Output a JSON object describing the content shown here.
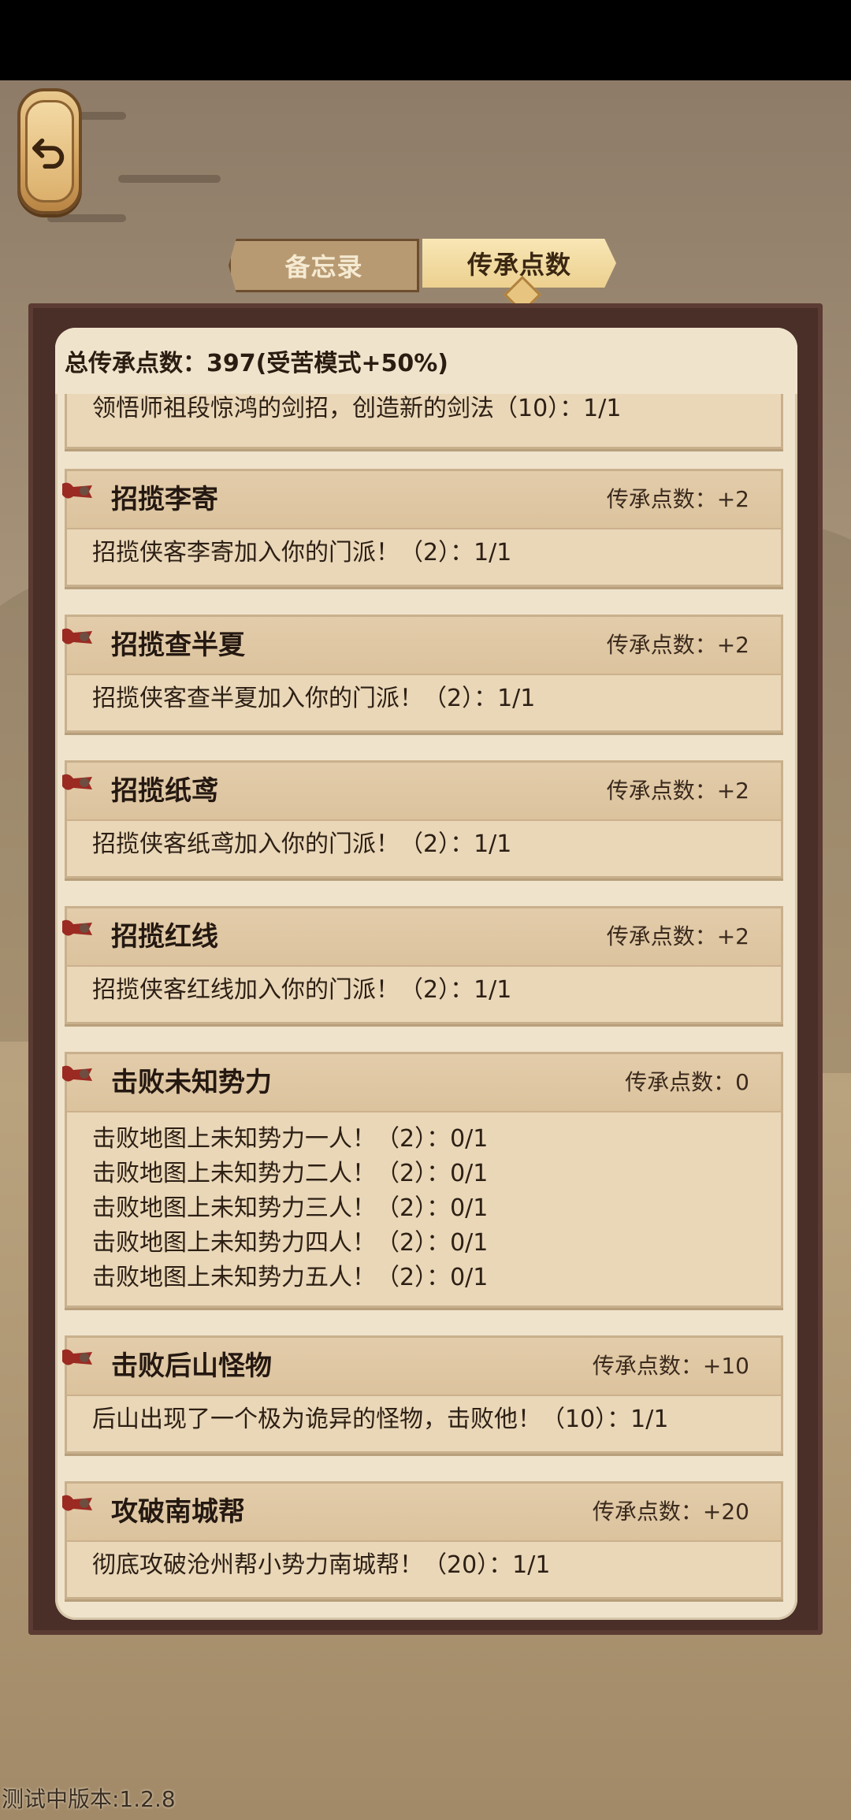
{
  "tabs": {
    "memo_label": "备忘录",
    "points_label": "传承点数"
  },
  "summary": {
    "total_label": "总传承点数：397(受苦模式+50%)"
  },
  "partial_top_item": {
    "line": "领悟师祖段惊鸿的剑招，创造新的剑法（10）：1/1"
  },
  "items": [
    {
      "title": "招揽李寄",
      "points": "传承点数：+2",
      "lines": [
        "招揽侠客李寄加入你的门派！（2）：1/1"
      ]
    },
    {
      "title": "招揽查半夏",
      "points": "传承点数：+2",
      "lines": [
        "招揽侠客查半夏加入你的门派！（2）：1/1"
      ]
    },
    {
      "title": "招揽纸鸢",
      "points": "传承点数：+2",
      "lines": [
        "招揽侠客纸鸢加入你的门派！（2）：1/1"
      ]
    },
    {
      "title": "招揽红线",
      "points": "传承点数：+2",
      "lines": [
        "招揽侠客红线加入你的门派！（2）：1/1"
      ]
    },
    {
      "title": "击败未知势力",
      "points": "传承点数：0",
      "lines": [
        "击败地图上未知势力一人！（2）：0/1",
        "击败地图上未知势力二人！（2）：0/1",
        "击败地图上未知势力三人！（2）：0/1",
        "击败地图上未知势力四人！（2）：0/1",
        "击败地图上未知势力五人！（2）：0/1"
      ]
    },
    {
      "title": "击败后山怪物",
      "points": "传承点数：+10",
      "lines": [
        "后山出现了一个极为诡异的怪物，击败他！（10）：1/1"
      ]
    },
    {
      "title": "攻破南城帮",
      "points": "传承点数：+20",
      "lines": [
        "彻底攻破沧州帮小势力南城帮！（20）：1/1"
      ]
    }
  ],
  "footer": {
    "version": "测试中版本:1.2.8"
  },
  "icons": {
    "back": "back-arrow-icon",
    "item_marker": "ribbon-tag-icon"
  },
  "colors": {
    "panel_frame": "#4a2e28",
    "paper": "#efe3cc",
    "card": "#ead7b8",
    "accent_ribbon": "#9b2a22"
  }
}
